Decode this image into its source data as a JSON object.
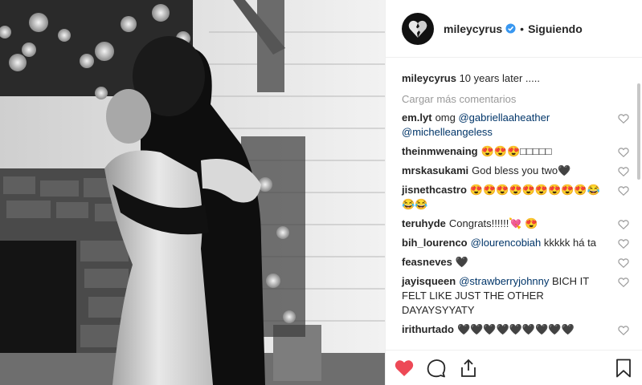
{
  "post": {
    "username": "mileycyrus",
    "separator": "•",
    "follow_status": "Siguiendo",
    "caption": {
      "user": "mileycyrus",
      "text": "10 years later ....."
    },
    "load_more": "Cargar más comentarios"
  },
  "comments": [
    {
      "user": "em.lyt",
      "segments": [
        {
          "t": "text",
          "v": "omg "
        },
        {
          "t": "mention",
          "v": "@gabriellaaheather"
        },
        {
          "t": "text",
          "v": " "
        },
        {
          "t": "mention",
          "v": "@michelleangeless"
        }
      ]
    },
    {
      "user": "theinmwenaing",
      "segments": [
        {
          "t": "text",
          "v": "😍😍😍□□□□□"
        }
      ]
    },
    {
      "user": "mrskasukami",
      "segments": [
        {
          "t": "text",
          "v": "God bless you two🖤"
        }
      ]
    },
    {
      "user": "jisnethcastro",
      "segments": [
        {
          "t": "text",
          "v": "😍😍😍😍😍😍😍😍😍😂😂😂"
        }
      ]
    },
    {
      "user": "teruhyde",
      "segments": [
        {
          "t": "text",
          "v": "Congrats!!!!!!💘 😍"
        }
      ]
    },
    {
      "user": "bih_lourenco",
      "segments": [
        {
          "t": "mention",
          "v": "@lourencobiah"
        },
        {
          "t": "text",
          "v": " kkkkk há ta"
        }
      ]
    },
    {
      "user": "feasneves",
      "segments": [
        {
          "t": "text",
          "v": "🖤"
        }
      ]
    },
    {
      "user": "jayisqueen",
      "segments": [
        {
          "t": "mention",
          "v": "@strawberryjohnny"
        },
        {
          "t": "text",
          "v": " BICH IT FELT LIKE JUST THE OTHER DAYAYSYYATY"
        }
      ]
    },
    {
      "user": "irithurtado",
      "segments": [
        {
          "t": "text",
          "v": "🖤🖤🖤🖤🖤🖤🖤🖤🖤"
        }
      ]
    }
  ],
  "icons": {
    "like": "heart-filled-icon",
    "comment": "comment-bubble-icon",
    "share": "share-icon",
    "save": "bookmark-icon",
    "verified": "verified-badge-icon"
  },
  "colors": {
    "like_red": "#ed4956",
    "verified_blue": "#3897f0",
    "mention": "#003569",
    "muted": "#999999"
  }
}
